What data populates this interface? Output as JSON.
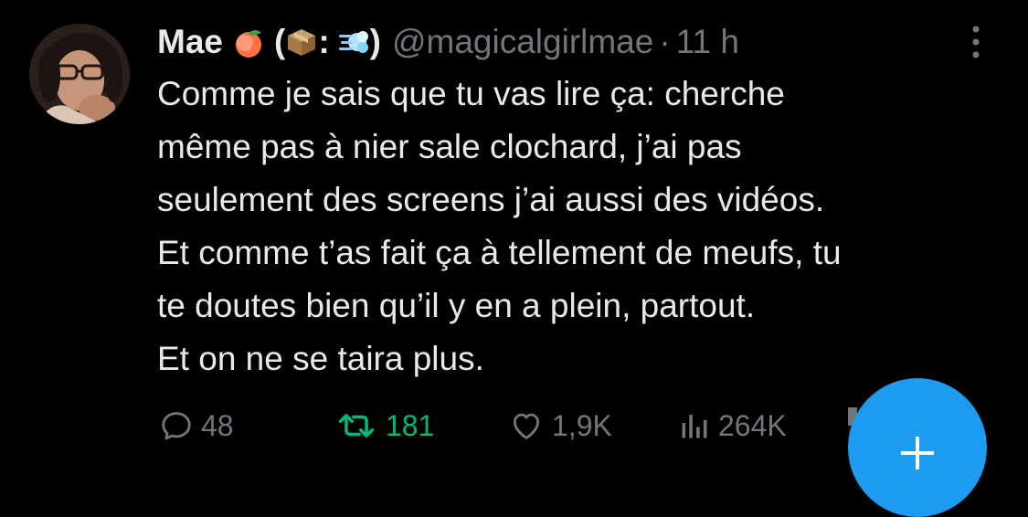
{
  "tweet": {
    "display_name": "Mae",
    "name_emojis": [
      "peach-emoji",
      "package-emoji",
      "dash-emoji"
    ],
    "name_open_paren": "(",
    "name_colon": ":",
    "name_close_paren": ")",
    "handle": "@magicalgirlmae",
    "separator": "·",
    "time": "11 h",
    "text_lines": [
      "Comme je sais que tu vas lire ça: cherche",
      "même pas à nier sale clochard, j’ai pas",
      "seulement des screens j’ai aussi des vidéos.",
      "Et comme t’as fait ça à tellement de meufs, tu",
      "te doutes bien qu’il y en a plein, partout.",
      "Et on ne se taira plus."
    ]
  },
  "actions": {
    "replies": {
      "icon": "reply-icon",
      "count": "48"
    },
    "retweets": {
      "icon": "retweet-icon",
      "count": "181",
      "color": "#00ba7c"
    },
    "likes": {
      "icon": "heart-icon",
      "count": "1,9K"
    },
    "views": {
      "icon": "views-icon",
      "count": "264K"
    }
  },
  "fab": {
    "icon": "plus-icon",
    "color": "#1d9bf0"
  },
  "colors": {
    "background": "#000000",
    "text": "#e7e9ea",
    "secondary": "#71767b",
    "accent": "#1d9bf0",
    "retweet": "#00ba7c"
  }
}
